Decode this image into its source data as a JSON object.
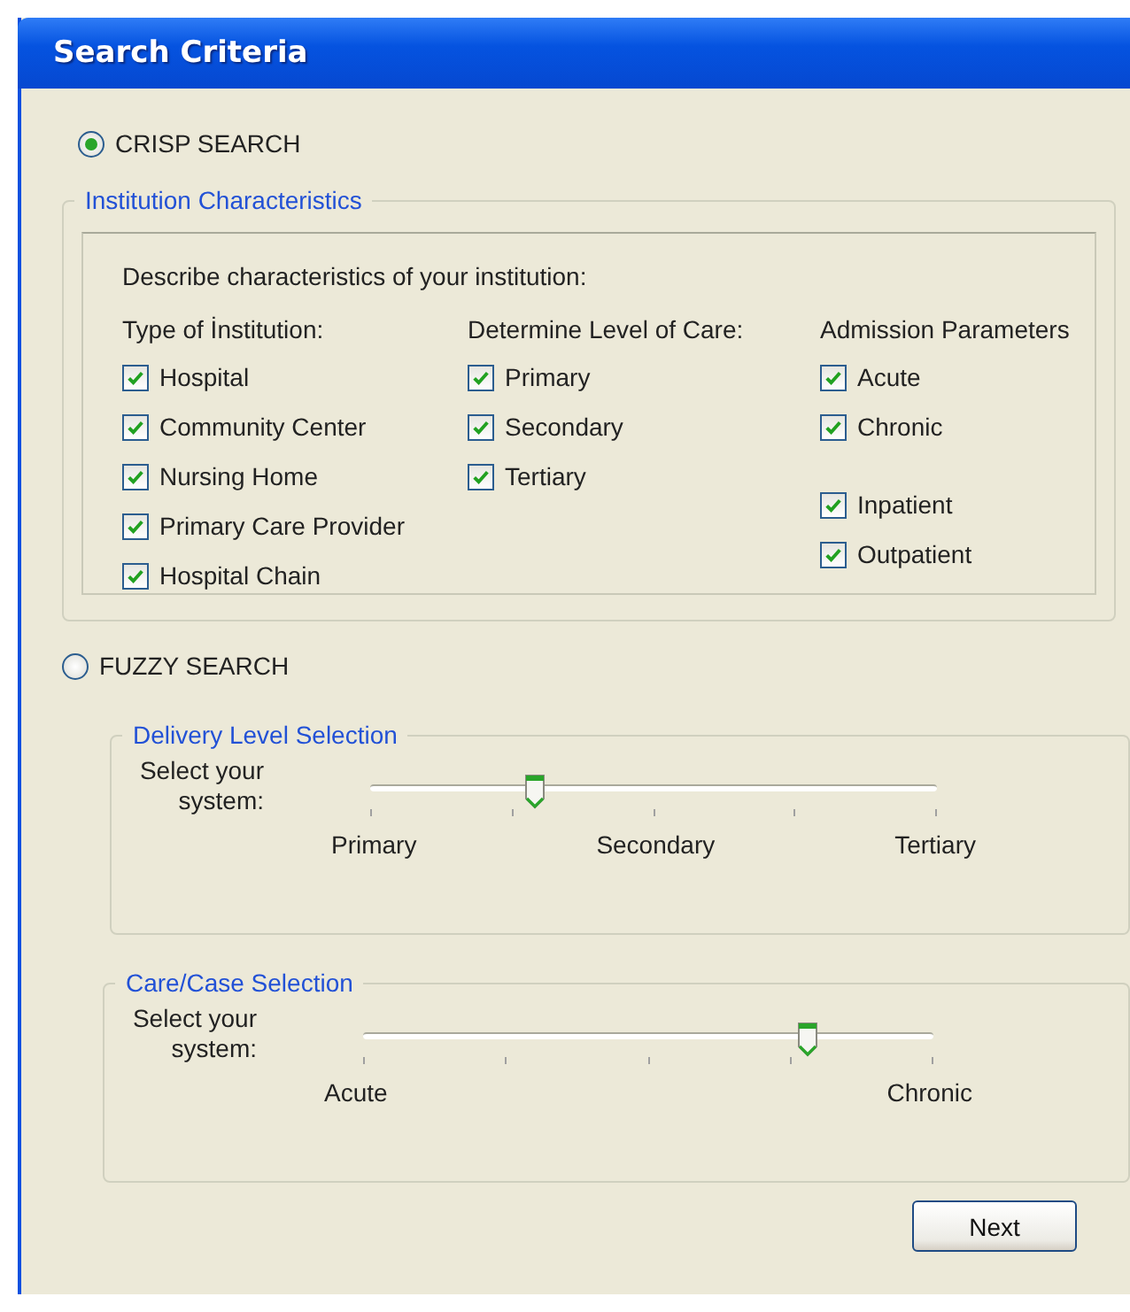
{
  "window": {
    "title": "Search Criteria"
  },
  "modes": [
    {
      "label": "CRISP SEARCH",
      "selected": true
    },
    {
      "label": "FUZZY SEARCH",
      "selected": false
    }
  ],
  "institution": {
    "title": "Institution Characteristics",
    "prompt": "Describe characteristics of your institution:",
    "columns": [
      {
        "heading": "Type of İnstitution:",
        "groups": [
          [
            {
              "label": "Hospital",
              "checked": true
            },
            {
              "label": "Community Center",
              "checked": true
            },
            {
              "label": "Nursing Home",
              "checked": true
            },
            {
              "label": "Primary Care Provider",
              "checked": true
            },
            {
              "label": "Hospital Chain",
              "checked": true
            }
          ]
        ]
      },
      {
        "heading": "Determine Level of Care:",
        "groups": [
          [
            {
              "label": "Primary",
              "checked": true
            },
            {
              "label": "Secondary",
              "checked": true
            },
            {
              "label": "Tertiary",
              "checked": true
            }
          ]
        ]
      },
      {
        "heading": "Admission Parameters",
        "groups": [
          [
            {
              "label": "Acute",
              "checked": true
            },
            {
              "label": "Chronic",
              "checked": true
            }
          ],
          [
            {
              "label": "Inpatient",
              "checked": true
            },
            {
              "label": "Outpatient",
              "checked": true
            }
          ]
        ]
      }
    ]
  },
  "sliders": [
    {
      "title": "Delivery Level Selection",
      "label": "Select your system:",
      "level": 0.29,
      "tick_labels": [
        "Primary",
        "Secondary",
        "Tertiary"
      ]
    },
    {
      "title": "Care/Case Selection",
      "label": "Select your system:",
      "level": 0.78,
      "tick_labels": [
        "Acute",
        "Chronic"
      ]
    }
  ],
  "buttons": [
    {
      "label": "Next"
    }
  ]
}
